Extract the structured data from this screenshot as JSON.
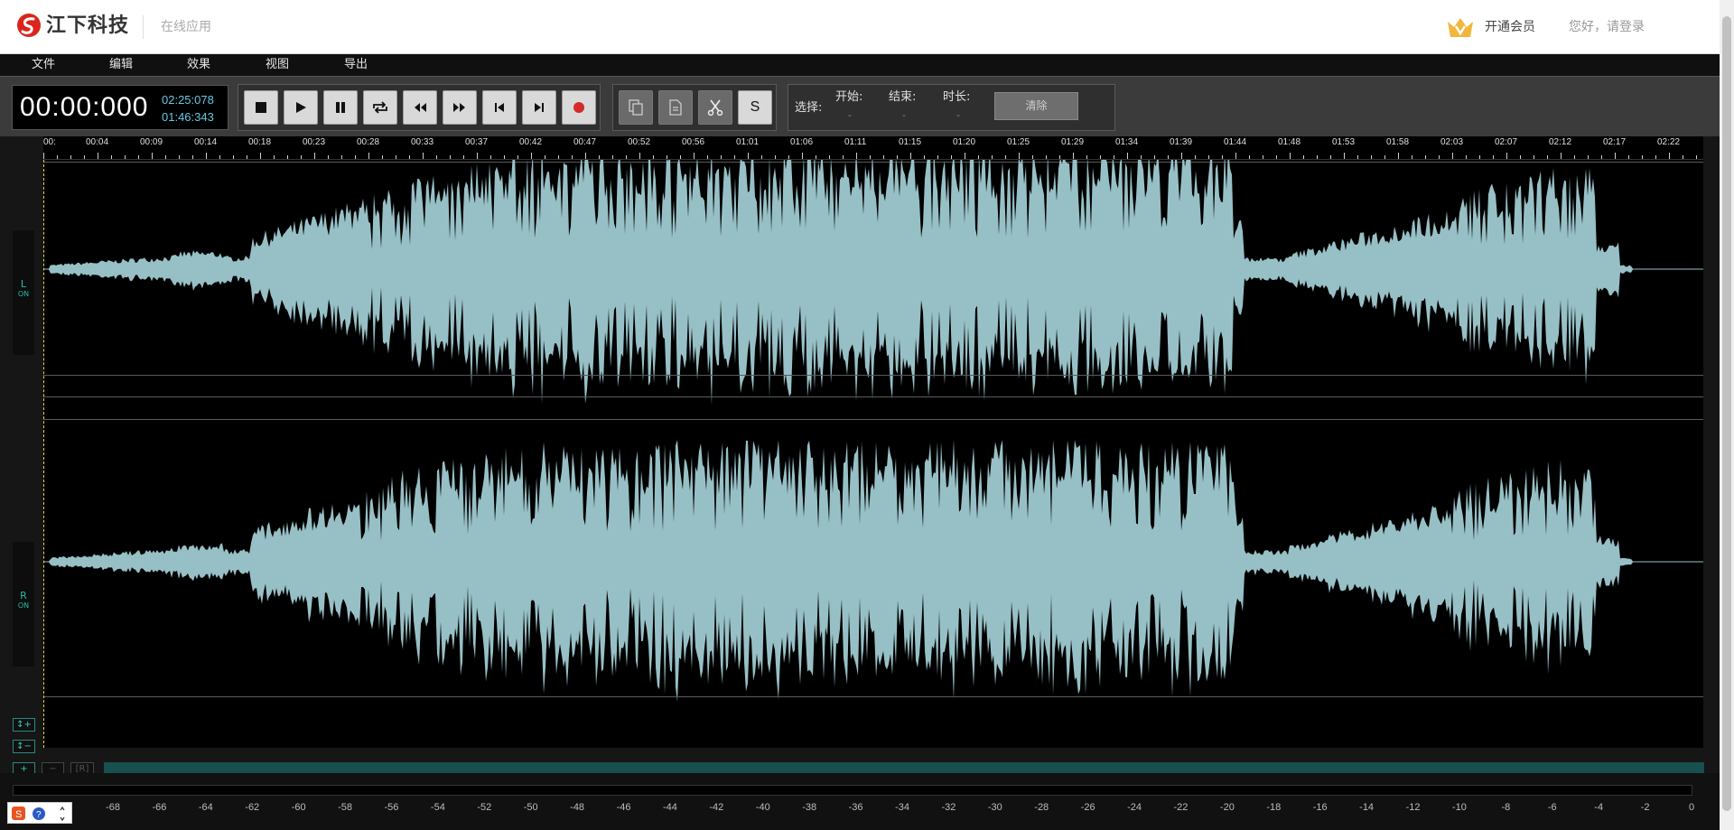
{
  "header": {
    "brand": "江下科技",
    "subtitle": "在线应用",
    "vip_label": "开通会员",
    "login_label": "您好，请登录"
  },
  "menu": [
    {
      "label": "文件"
    },
    {
      "label": "编辑"
    },
    {
      "label": "效果"
    },
    {
      "label": "视图"
    },
    {
      "label": "导出"
    }
  ],
  "time": {
    "current": "00:00:000",
    "total": "02:25:078",
    "position": "01:46:343"
  },
  "toolbar": {
    "transport_icons": [
      "stop-icon",
      "play-icon",
      "pause-icon",
      "loop-icon",
      "rewind-icon",
      "fast-forward-icon",
      "skip-to-start-icon",
      "skip-to-end-icon",
      "record-icon"
    ],
    "edit_icons": [
      "copy-icon",
      "paste-icon",
      "cut-icon"
    ],
    "silence_label": "S"
  },
  "selection": {
    "label": "选择:",
    "start_label": "开始:",
    "start_value": "-",
    "end_label": "结束:",
    "end_value": "-",
    "duration_label": "时长:",
    "duration_value": "-",
    "clear_label": "清除"
  },
  "ruler": {
    "labels": [
      "00:",
      "00:04",
      "00:09",
      "00:14",
      "00:18",
      "00:23",
      "00:28",
      "00:33",
      "00:37",
      "00:42",
      "00:47",
      "00:52",
      "00:56",
      "01:01",
      "01:06",
      "01:11",
      "01:15",
      "01:20",
      "01:25",
      "01:29",
      "01:34",
      "01:39",
      "01:44",
      "01:48",
      "01:53",
      "01:58",
      "02:03",
      "02:07",
      "02:12",
      "02:17",
      "02:22"
    ]
  },
  "channels": {
    "left": {
      "name": "L",
      "state": "ON"
    },
    "right": {
      "name": "R",
      "state": "ON"
    }
  },
  "zoom_controls": {
    "v_zoom_in": "↕+",
    "v_zoom_out": "↕−",
    "h_zoom_in": "+",
    "h_zoom_out": "−",
    "reset": "[R]"
  },
  "meter": {
    "labels": [
      "-68",
      "-66",
      "-64",
      "-62",
      "-60",
      "-58",
      "-56",
      "-54",
      "-52",
      "-50",
      "-48",
      "-46",
      "-44",
      "-42",
      "-40",
      "-38",
      "-36",
      "-34",
      "-32",
      "-30",
      "-28",
      "-26",
      "-24",
      "-22",
      "-20",
      "-18",
      "-16",
      "-14",
      "-12",
      "-10",
      "-8",
      "-6",
      "-4",
      "-2",
      "0"
    ]
  },
  "colors": {
    "waveform": "#97c0c6",
    "accent": "#28b8a8",
    "record": "#d42a2a"
  }
}
